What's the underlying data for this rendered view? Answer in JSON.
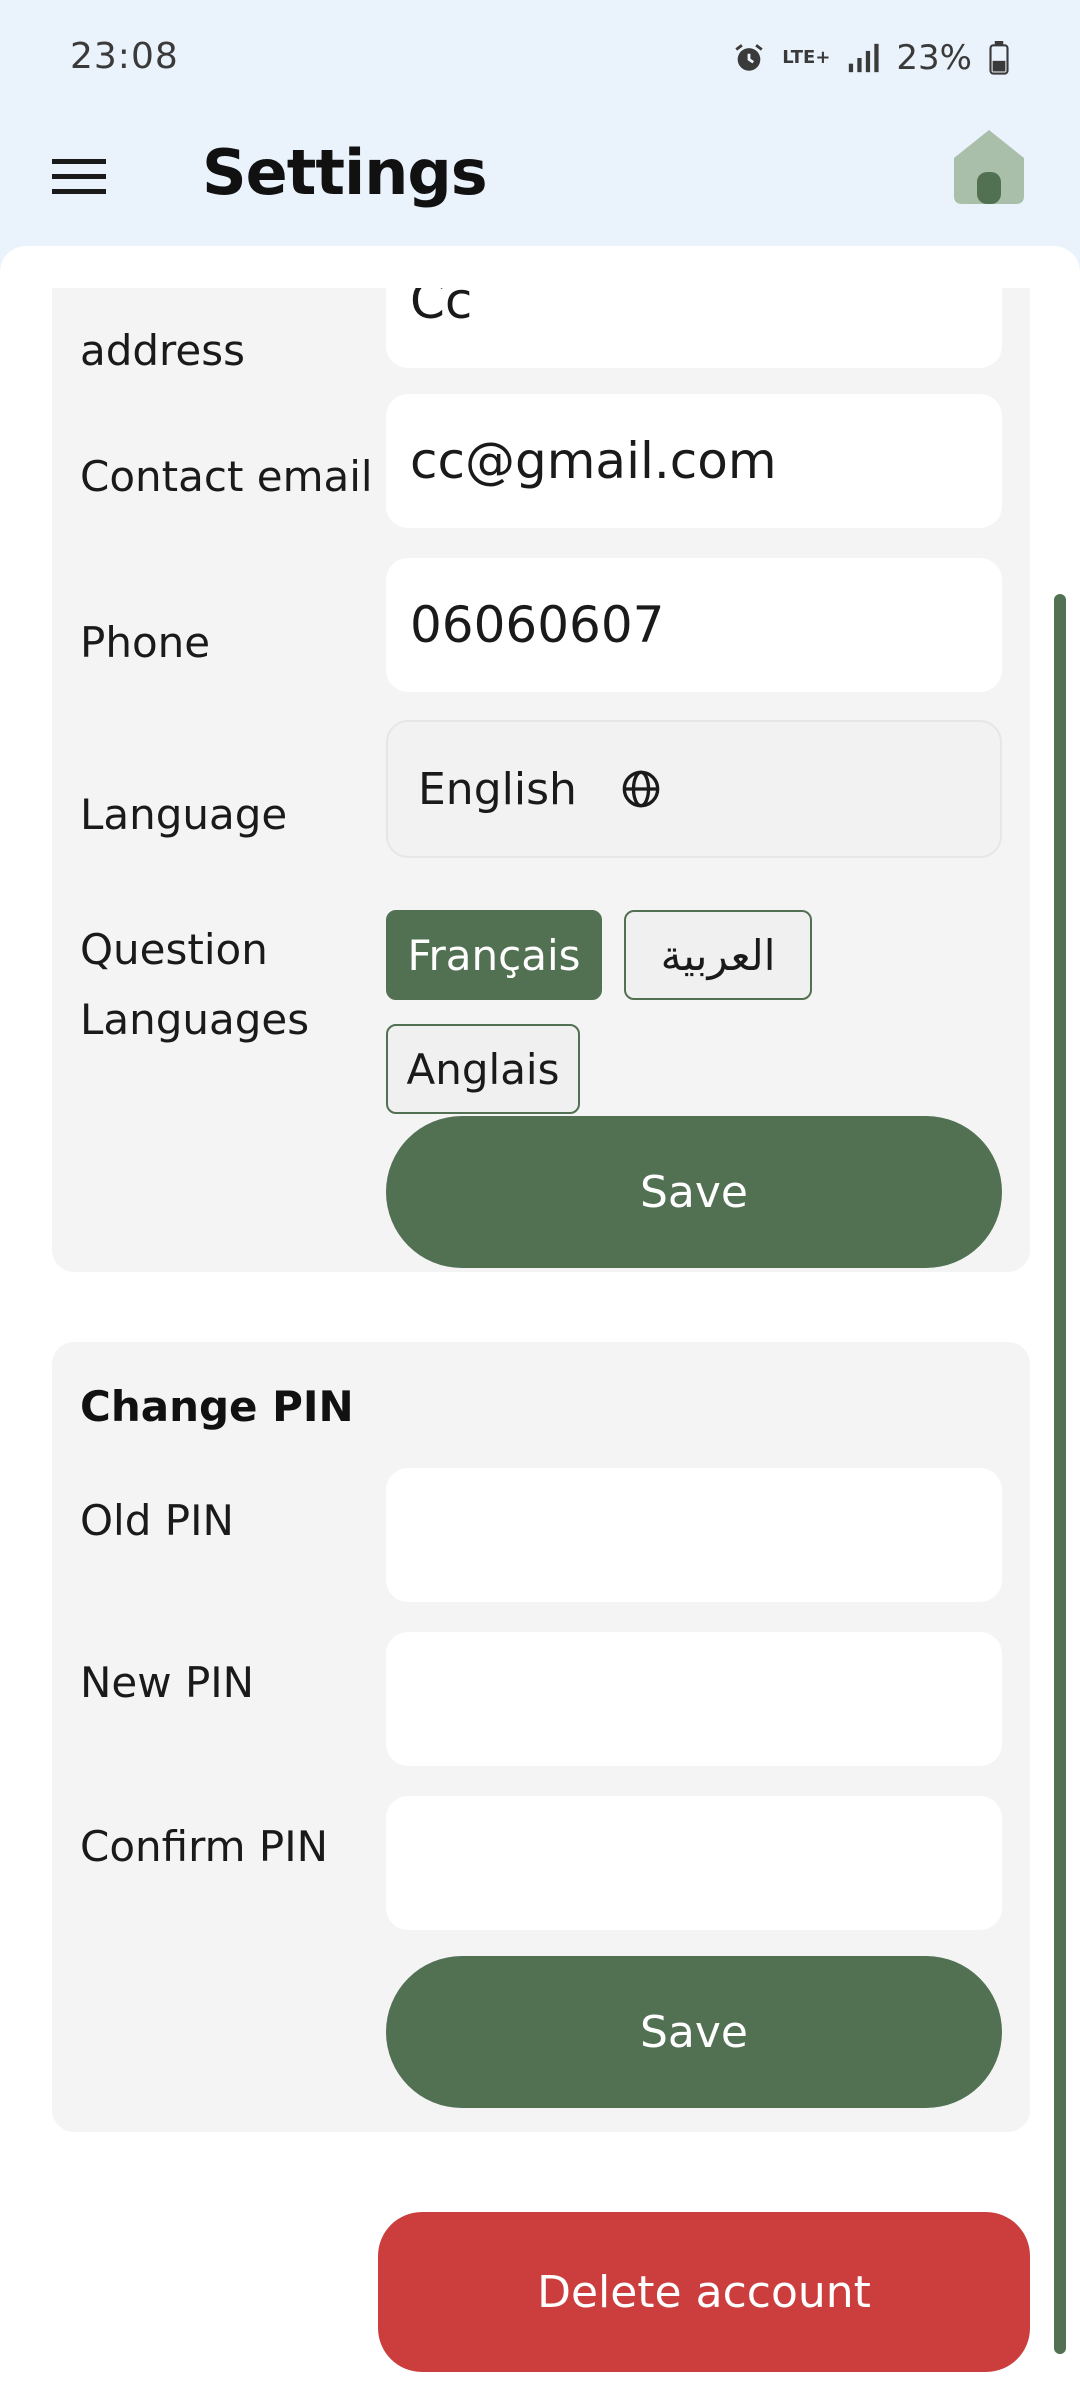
{
  "status_bar": {
    "time": "23:08",
    "battery": "23%",
    "network": "LTE+"
  },
  "app_bar": {
    "title": "Settings",
    "menu_icon": "hamburger-menu-icon",
    "home_icon": "home-icon"
  },
  "profile": {
    "address_label": "address",
    "address_value": "Cc",
    "email_label": "Contact email",
    "email_value": "cc@gmail.com",
    "phone_label": "Phone",
    "phone_value": "06060607",
    "language_label": "Language",
    "language_value": "English",
    "question_languages_label_1": "Question",
    "question_languages_label_2": "Languages",
    "question_languages": [
      {
        "label": "Français",
        "selected": true
      },
      {
        "label": "العربية",
        "selected": false
      },
      {
        "label": "Anglais",
        "selected": false
      }
    ],
    "save_label": "Save"
  },
  "change_pin": {
    "title": "Change PIN",
    "old_pin_label": "Old PIN",
    "new_pin_label": "New PIN",
    "confirm_pin_label": "Confirm PIN",
    "old_pin_value": "",
    "new_pin_value": "",
    "confirm_pin_value": "",
    "save_label": "Save"
  },
  "delete_account_label": "Delete account",
  "colors": {
    "accent": "#527052",
    "danger": "#cc3d3d",
    "appbar_bg": "#eaf2fc",
    "card_bg": "#f4f4f4"
  }
}
